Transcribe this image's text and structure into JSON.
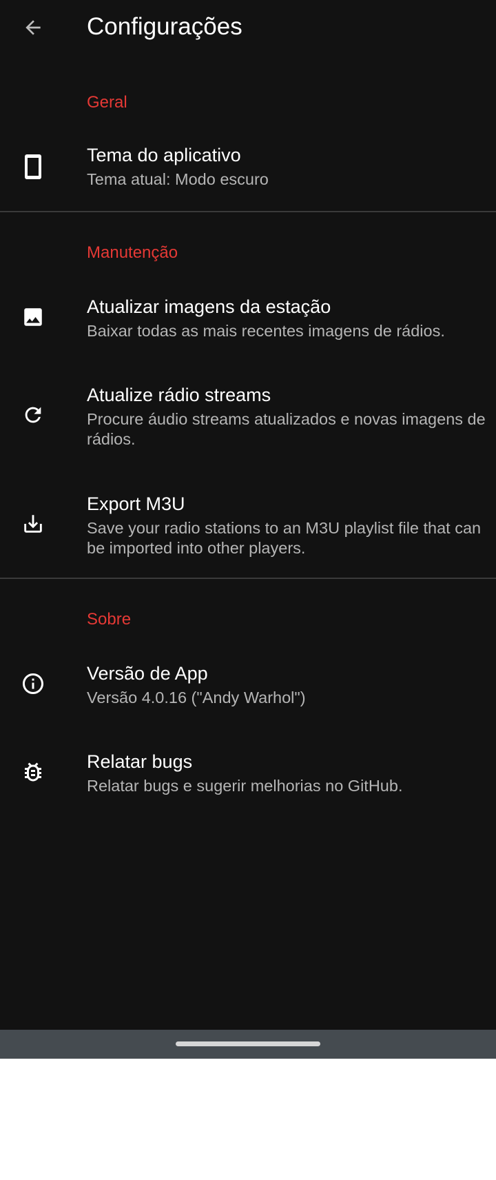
{
  "appbar": {
    "title": "Configurações",
    "back_icon": "arrow-back-icon"
  },
  "sections": [
    {
      "header": "Geral",
      "items": [
        {
          "title": "Tema do aplicativo",
          "summary": "Tema atual: Modo escuro",
          "icon": "smartphone-icon"
        }
      ]
    },
    {
      "header": "Manutenção",
      "items": [
        {
          "title": "Atualizar imagens da estação",
          "summary": "Baixar todas as mais recentes imagens de rádios.",
          "icon": "image-icon"
        },
        {
          "title": "Atualize rádio streams",
          "summary": "Procure áudio streams atualizados e novas imagens de rádios.",
          "icon": "refresh-icon"
        },
        {
          "title": "Export M3U",
          "summary": "Save your radio stations to an M3U playlist file that can be imported into other players.",
          "icon": "download-icon"
        }
      ]
    },
    {
      "header": "Sobre",
      "items": [
        {
          "title": "Versão de App",
          "summary": "Versão 4.0.16 (\"Andy Warhol\")",
          "icon": "info-icon"
        },
        {
          "title": "Relatar bugs",
          "summary": "Relatar bugs e sugerir melhorias no GitHub.",
          "icon": "bug-icon"
        }
      ]
    }
  ],
  "colors": {
    "background": "#121212",
    "accent": "#e53935",
    "title_text": "#ffffff",
    "summary_text": "#b5b5b5",
    "divider": "#3a3a3a",
    "navbar": "#454b50"
  }
}
